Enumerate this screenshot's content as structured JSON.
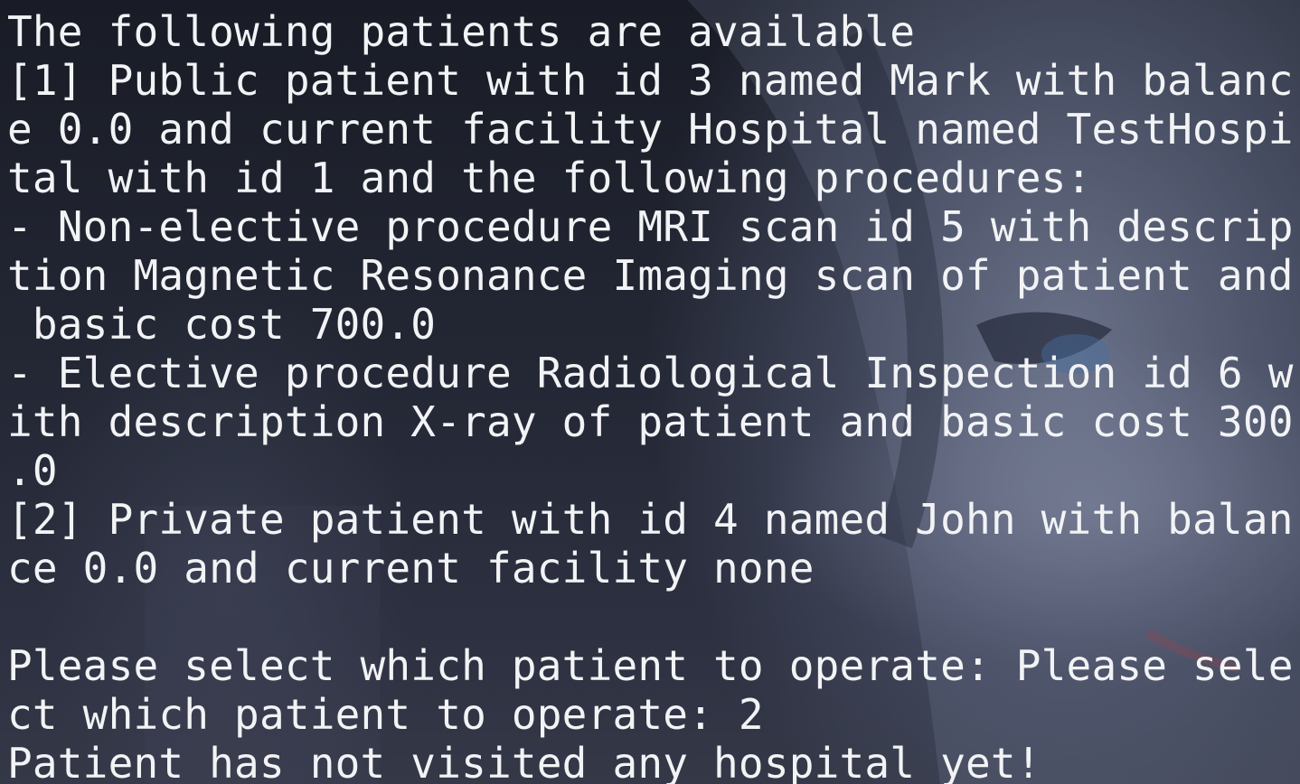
{
  "terminal": {
    "lines": [
      "The following patients are available",
      "[1] Public patient with id 3 named Mark with balanc",
      "e 0.0 and current facility Hospital named TestHospi",
      "tal with id 1 and the following procedures:",
      "- Non-elective procedure MRI scan id 5 with descrip",
      "tion Magnetic Resonance Imaging scan of patient and",
      " basic cost 700.0",
      "- Elective procedure Radiological Inspection id 6 w",
      "ith description X-ray of patient and basic cost 300",
      ".0",
      "[2] Private patient with id 4 named John with balan",
      "ce 0.0 and current facility none",
      "",
      "Please select which patient to operate: Please sele",
      "ct which patient to operate: 2",
      "Patient has not visited any hospital yet!"
    ]
  },
  "colors": {
    "text": "#f2f3f5",
    "background": "#1b1e29"
  }
}
